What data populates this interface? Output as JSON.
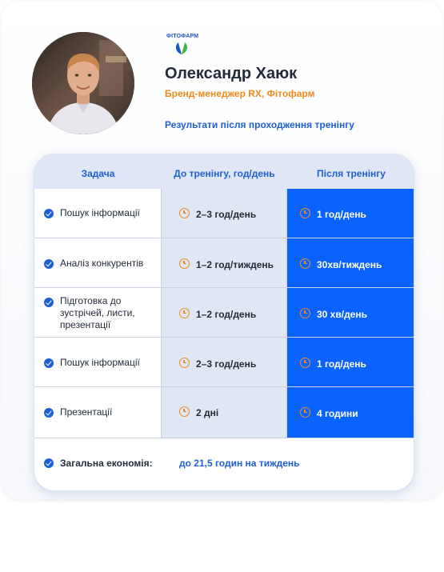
{
  "profile": {
    "name": "Олександр Хаюк",
    "role": "Бренд-менеджер RX, Фітофарм",
    "results_title": "Результати після проходження тренінгу",
    "logo_text": "ФІТОФАРМ"
  },
  "table": {
    "headers": {
      "task": "Задача",
      "before": "До тренінгу, год/день",
      "after": "Після тренінгу"
    },
    "rows": [
      {
        "task": "Пошук інформації",
        "before": "2–3 год/день",
        "after": "1 год/день"
      },
      {
        "task": "Аналіз конкурентів",
        "before": "1–2 год/тиждень",
        "after": "30хв/тиждень"
      },
      {
        "task": "Підготовка до зустрічей, листи, презентації",
        "before": "1–2 год/день",
        "after": "30 хв/день"
      },
      {
        "task": "Пошук інформації",
        "before": "2–3 год/день",
        "after": "1 год/день"
      },
      {
        "task": "Презентації",
        "before": "2 дні",
        "after": "4 години"
      }
    ],
    "total": {
      "label": "Загальна економія:",
      "value": "до 21,5 годин на тиждень"
    }
  },
  "colors": {
    "accent_blue": "#1e5fd8",
    "after_column": "#0b63ff",
    "orange": "#f08a1d",
    "before_column": "#dfe7f5"
  },
  "icons": {
    "check": "check-circle-icon",
    "clock": "clock-icon"
  }
}
